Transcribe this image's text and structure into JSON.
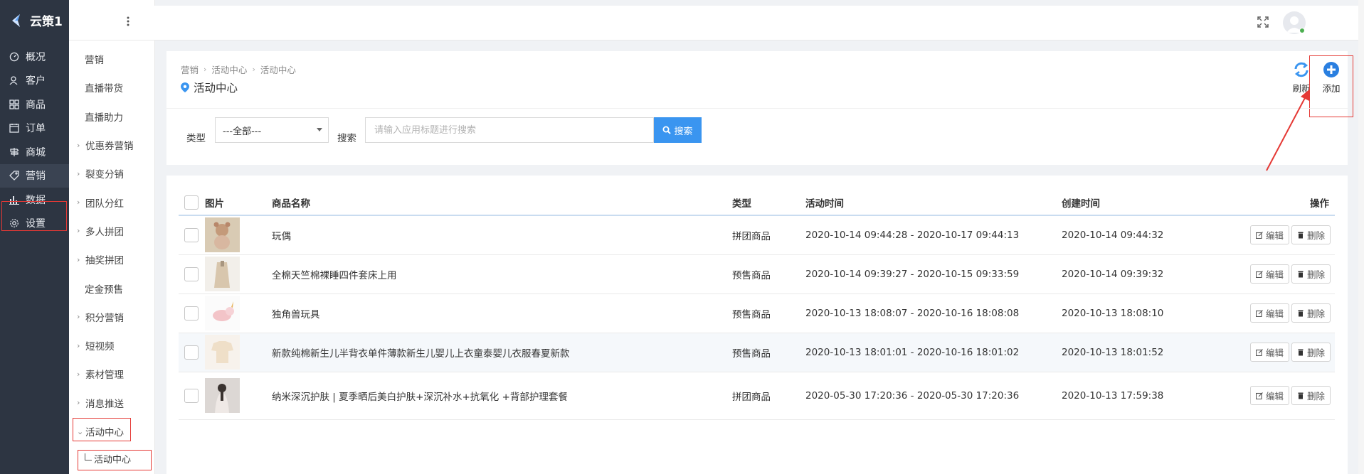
{
  "app": {
    "name": "云策1"
  },
  "nav": {
    "items": [
      {
        "label": "概况",
        "icon": "gauge-icon"
      },
      {
        "label": "客户",
        "icon": "user-icon"
      },
      {
        "label": "商品",
        "icon": "grid-icon"
      },
      {
        "label": "订单",
        "icon": "calendar-icon"
      },
      {
        "label": "商城",
        "icon": "signpost-icon"
      },
      {
        "label": "营销",
        "icon": "tag-icon"
      },
      {
        "label": "数据",
        "icon": "bar-chart-icon"
      },
      {
        "label": "设置",
        "icon": "gear-icon"
      }
    ],
    "active": "营销"
  },
  "subnav": {
    "items": [
      {
        "label": "营销",
        "arrow": false
      },
      {
        "label": "直播带货",
        "arrow": false
      },
      {
        "label": "直播助力",
        "arrow": false
      },
      {
        "label": "优惠券营销",
        "arrow": true
      },
      {
        "label": "裂变分销",
        "arrow": true
      },
      {
        "label": "团队分红",
        "arrow": true
      },
      {
        "label": "多人拼团",
        "arrow": true
      },
      {
        "label": "抽奖拼团",
        "arrow": true
      },
      {
        "label": "定金预售",
        "arrow": false
      },
      {
        "label": "积分营销",
        "arrow": true
      },
      {
        "label": "短视频",
        "arrow": true
      },
      {
        "label": "素材管理",
        "arrow": true
      },
      {
        "label": "消息推送",
        "arrow": true
      },
      {
        "label": "活动中心",
        "arrow": true,
        "expanded": true
      }
    ],
    "child": "活动中心"
  },
  "header": {
    "breadcrumb": [
      "营销",
      "活动中心",
      "活动中心"
    ],
    "title": "活动中心",
    "refresh_label": "刷新",
    "add_label": "添加"
  },
  "filters": {
    "type_label": "类型",
    "type_value": "---全部---",
    "search_label": "搜索",
    "search_placeholder": "请输入应用标题进行搜索",
    "search_button": "搜索"
  },
  "table": {
    "columns": [
      "图片",
      "商品名称",
      "类型",
      "活动时间",
      "创建时间",
      "操作"
    ],
    "edit_label": "编辑",
    "delete_label": "删除",
    "rows": [
      {
        "name": "玩偶",
        "type": "拼团商品",
        "activity_time": "2020-10-14 09:44:28 - 2020-10-17 09:44:13",
        "created": "2020-10-14 09:44:32",
        "thumb": "plush-bear"
      },
      {
        "name": "全棉天竺棉裸睡四件套床上用",
        "type": "预售商品",
        "activity_time": "2020-10-14 09:39:27 - 2020-10-15 09:33:59",
        "created": "2020-10-14 09:39:32",
        "thumb": "coat"
      },
      {
        "name": "独角兽玩具",
        "type": "预售商品",
        "activity_time": "2020-10-13 18:08:07 - 2020-10-16 18:08:08",
        "created": "2020-10-13 18:08:10",
        "thumb": "unicorn"
      },
      {
        "name": "新款纯棉新生儿半背衣单件薄款新生儿婴儿上衣童泰婴儿衣服春夏新款",
        "type": "预售商品",
        "activity_time": "2020-10-13 18:01:01 - 2020-10-16 18:01:02",
        "created": "2020-10-13 18:01:52",
        "thumb": "baby-shirt"
      },
      {
        "name": "纳米深沉护肤 | 夏季晒后美白护肤+深沉补水+抗氧化 +背部护理套餐",
        "type": "拼团商品",
        "activity_time": "2020-05-30 17:20:36 - 2020-05-30 17:20:36",
        "created": "2020-10-13 17:59:38",
        "thumb": "woman-back"
      }
    ]
  }
}
